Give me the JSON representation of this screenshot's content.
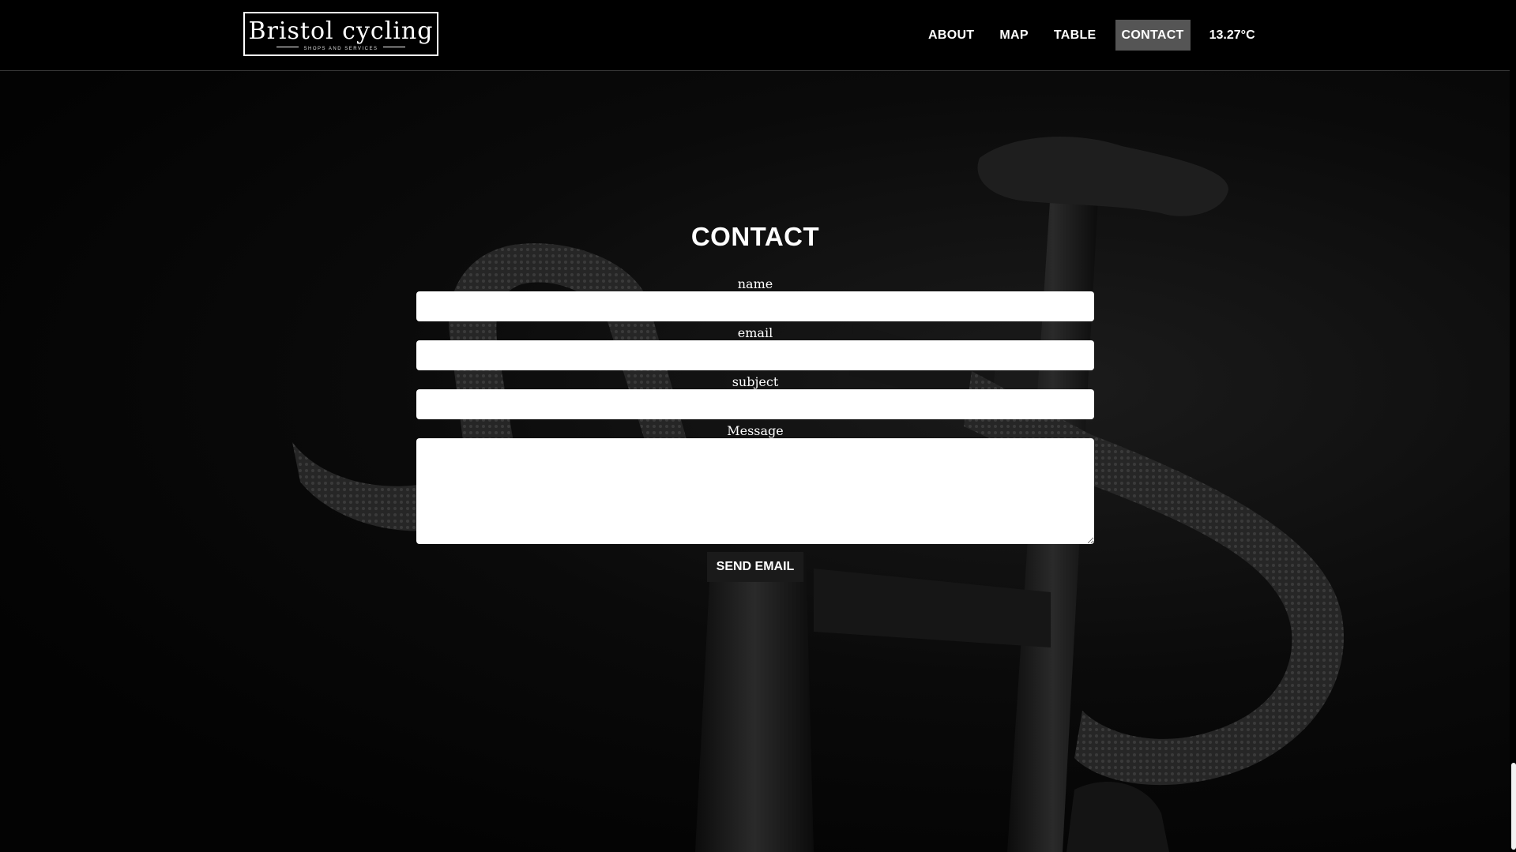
{
  "header": {
    "logo_title": "Bristol cycling",
    "logo_subtitle": "SHOPS AND SERVICES",
    "nav": [
      {
        "label": "ABOUT"
      },
      {
        "label": "MAP"
      },
      {
        "label": "TABLE"
      },
      {
        "label": "CONTACT",
        "active": true
      }
    ],
    "temperature": "13.27°C"
  },
  "contact": {
    "title": "CONTACT",
    "fields": {
      "name": {
        "label": "name",
        "value": ""
      },
      "email": {
        "label": "email",
        "value": ""
      },
      "subject": {
        "label": "subject",
        "value": ""
      },
      "message": {
        "label": "Message",
        "value": ""
      }
    },
    "send_label": "SEND EMAIL"
  },
  "colors": {
    "background": "#000000",
    "active_nav_bg": "#555555",
    "button_bg": "#1a1a1a",
    "text": "#ffffff"
  }
}
